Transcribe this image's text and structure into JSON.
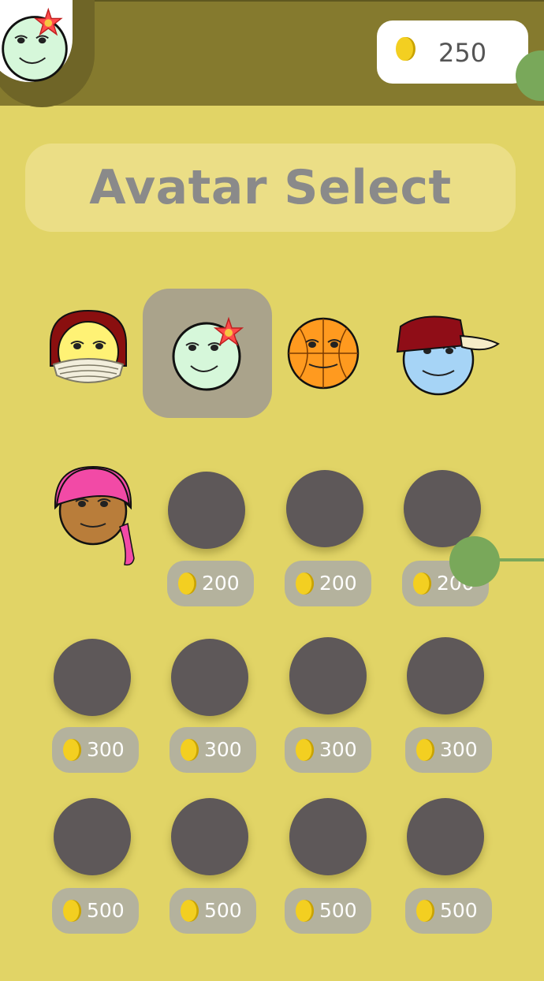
{
  "header": {
    "coin_count": "250",
    "profile_avatar": "flower-face-icon"
  },
  "title": "Avatar Select",
  "unlocked_avatars": [
    {
      "name": "bandana-face-icon"
    },
    {
      "name": "flower-face-icon",
      "selected": true
    },
    {
      "name": "basketball-face-icon"
    },
    {
      "name": "cap-face-icon"
    },
    {
      "name": "pink-headscarf-face-icon"
    }
  ],
  "locked_rows": [
    {
      "prices": [
        "200",
        "200",
        "200"
      ]
    },
    {
      "prices": [
        "300",
        "300",
        "300",
        "300"
      ]
    },
    {
      "prices": [
        "500",
        "500",
        "500",
        "500"
      ]
    }
  ],
  "colors": {
    "background": "#e1d466",
    "topbar": "#857a2e",
    "locked_avatar": "#5e5859",
    "price_pill": "#b4b29d",
    "selected_highlight": "#aaa38b",
    "overlay_dot": "#79a85a"
  }
}
